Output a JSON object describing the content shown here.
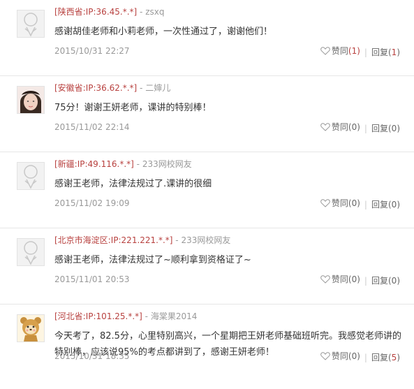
{
  "comments": [
    {
      "location": "[陕西省:IP:36.45.*.*]",
      "user": "zsxq",
      "avatar": "default",
      "text": "感谢胡佳老师和小莉老师，一次性通过了，谢谢他们！",
      "date": "2015/10/31 22:27",
      "like_label": "赞同",
      "like_count": "(1)",
      "reply_label": "回复",
      "reply_open": "(",
      "reply_count": "1",
      "reply_close": ")"
    },
    {
      "location": "[安徽省:IP:36.62.*.*]",
      "user": "二婶儿",
      "avatar": "photo",
      "text": "75分！谢谢王妍老师，课讲的特别棒！",
      "date": "2015/11/02 22:14",
      "like_label": "赞同",
      "like_count": "(0)",
      "reply_label": "回复",
      "reply_open": "(",
      "reply_count": "0",
      "reply_close": ")"
    },
    {
      "location": "[新疆:IP:49.116.*.*]",
      "user": "233网校网友",
      "avatar": "default",
      "text": "感谢王老师，法律法规过了.课讲的很细",
      "date": "2015/11/02 19:09",
      "like_label": "赞同",
      "like_count": "(0)",
      "reply_label": "回复",
      "reply_open": "(",
      "reply_count": "0",
      "reply_close": ")"
    },
    {
      "location": "[北京市海淀区:IP:221.221.*.*]",
      "user": "233网校网友",
      "avatar": "default",
      "text": "感谢王老师，法律法规过了~顺利拿到资格证了~",
      "date": "2015/11/01 20:53",
      "like_label": "赞同",
      "like_count": "(0)",
      "reply_label": "回复",
      "reply_open": "(",
      "reply_count": "0",
      "reply_close": ")"
    },
    {
      "location": "[河北省:IP:101.25.*.*]",
      "user": "海棠果2014",
      "avatar": "cartoon",
      "text": "今天考了，82.5分，心里特别高兴，一个星期把王妍老师基础班听完。我感觉老师讲的特别棒，应该说95%的考点都讲到了，感谢王妍老师！",
      "date": "2015/10/31 18:35",
      "like_label": "赞同",
      "like_count": "(0)",
      "reply_label": "回复",
      "reply_open": "(",
      "reply_count": "5",
      "reply_close": ")"
    }
  ],
  "separator": " - ",
  "divider": "|",
  "colors": {
    "location": "#b8413f",
    "meta": "#999999",
    "count_highlight": "#b8413f"
  }
}
